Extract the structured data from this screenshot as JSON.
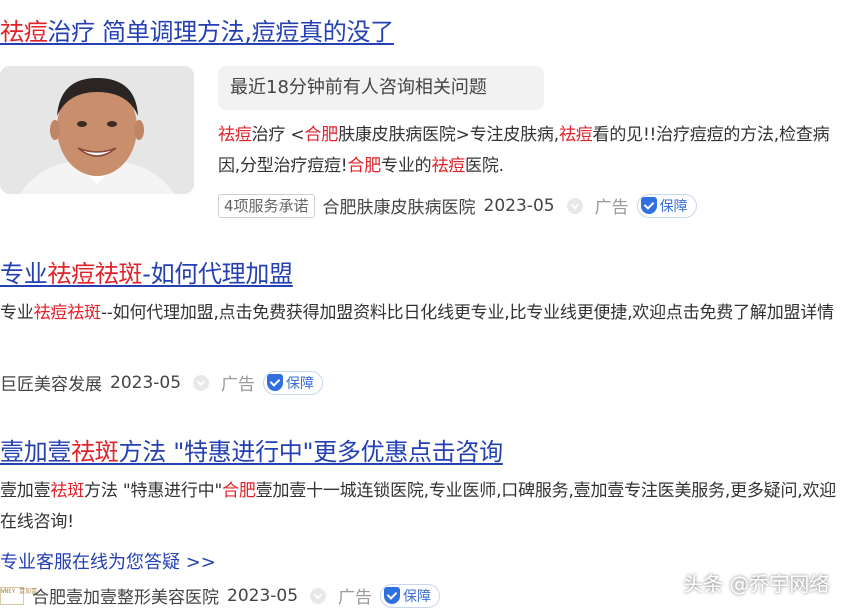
{
  "ad1": {
    "title": [
      {
        "t": "祛痘",
        "hl": true
      },
      {
        "t": "治疗 简单调理方法,痘痘真的没了",
        "hl": false
      }
    ],
    "notice": "最近18分钟前有人咨询相关问题",
    "desc": [
      {
        "t": "祛痘",
        "hl": true
      },
      {
        "t": "治疗 <",
        "hl": false
      },
      {
        "t": "合肥",
        "hl": true
      },
      {
        "t": "肤康皮肤病医院>专注皮肤病,",
        "hl": false
      },
      {
        "t": "祛痘",
        "hl": true
      },
      {
        "t": "看的见!!治疗痘痘的方法,检查病因,分型治疗痘痘!",
        "hl": false
      },
      {
        "t": "合肥",
        "hl": true
      },
      {
        "t": "专业的",
        "hl": false
      },
      {
        "t": "祛痘",
        "hl": true
      },
      {
        "t": "医院.",
        "hl": false
      }
    ],
    "service_tag": "4项服务承诺",
    "source": "合肥肤康皮肤病医院",
    "date": "2023-05",
    "ad_label": "广告",
    "guarantee": "保障"
  },
  "ad2": {
    "title": [
      {
        "t": "专业",
        "hl": false
      },
      {
        "t": "祛痘祛斑",
        "hl": true
      },
      {
        "t": "-如何代理加盟",
        "hl": false
      }
    ],
    "desc": [
      {
        "t": "专业",
        "hl": false
      },
      {
        "t": "祛痘祛斑",
        "hl": true
      },
      {
        "t": "--如何代理加盟,点击免费获得加盟资料比日化线更专业,比专业线更便捷,欢迎点击免费了解加盟详情",
        "hl": false
      }
    ],
    "source": "巨匠美容发展",
    "date": "2023-05",
    "ad_label": "广告",
    "guarantee": "保障"
  },
  "ad3": {
    "title": [
      {
        "t": "壹加壹",
        "hl": false
      },
      {
        "t": "祛斑",
        "hl": true
      },
      {
        "t": "方法 \"特惠进行中\"更多优惠点击咨询",
        "hl": false
      }
    ],
    "desc": [
      {
        "t": "壹加壹",
        "hl": false
      },
      {
        "t": "祛斑",
        "hl": true
      },
      {
        "t": "方法 \"特惠进行中\"",
        "hl": false
      },
      {
        "t": "合肥",
        "hl": true
      },
      {
        "t": "壹加壹十一城连锁医院,专业医师,口碑服务,壹加壹专注医美服务,更多疑问,欢迎在线咨询!",
        "hl": false
      }
    ],
    "more_link": "专业客服在线为您答疑 >>",
    "logo_text": "WNEY 壹加壹",
    "source": "合肥壹加壹整形美容医院",
    "date": "2023-05",
    "ad_label": "广告",
    "guarantee": "保障"
  },
  "watermark": "头条 @乔宇网络",
  "colors": {
    "link": "#2440b3",
    "highlight": "#e0232b",
    "badge": "#2f6fe0"
  }
}
